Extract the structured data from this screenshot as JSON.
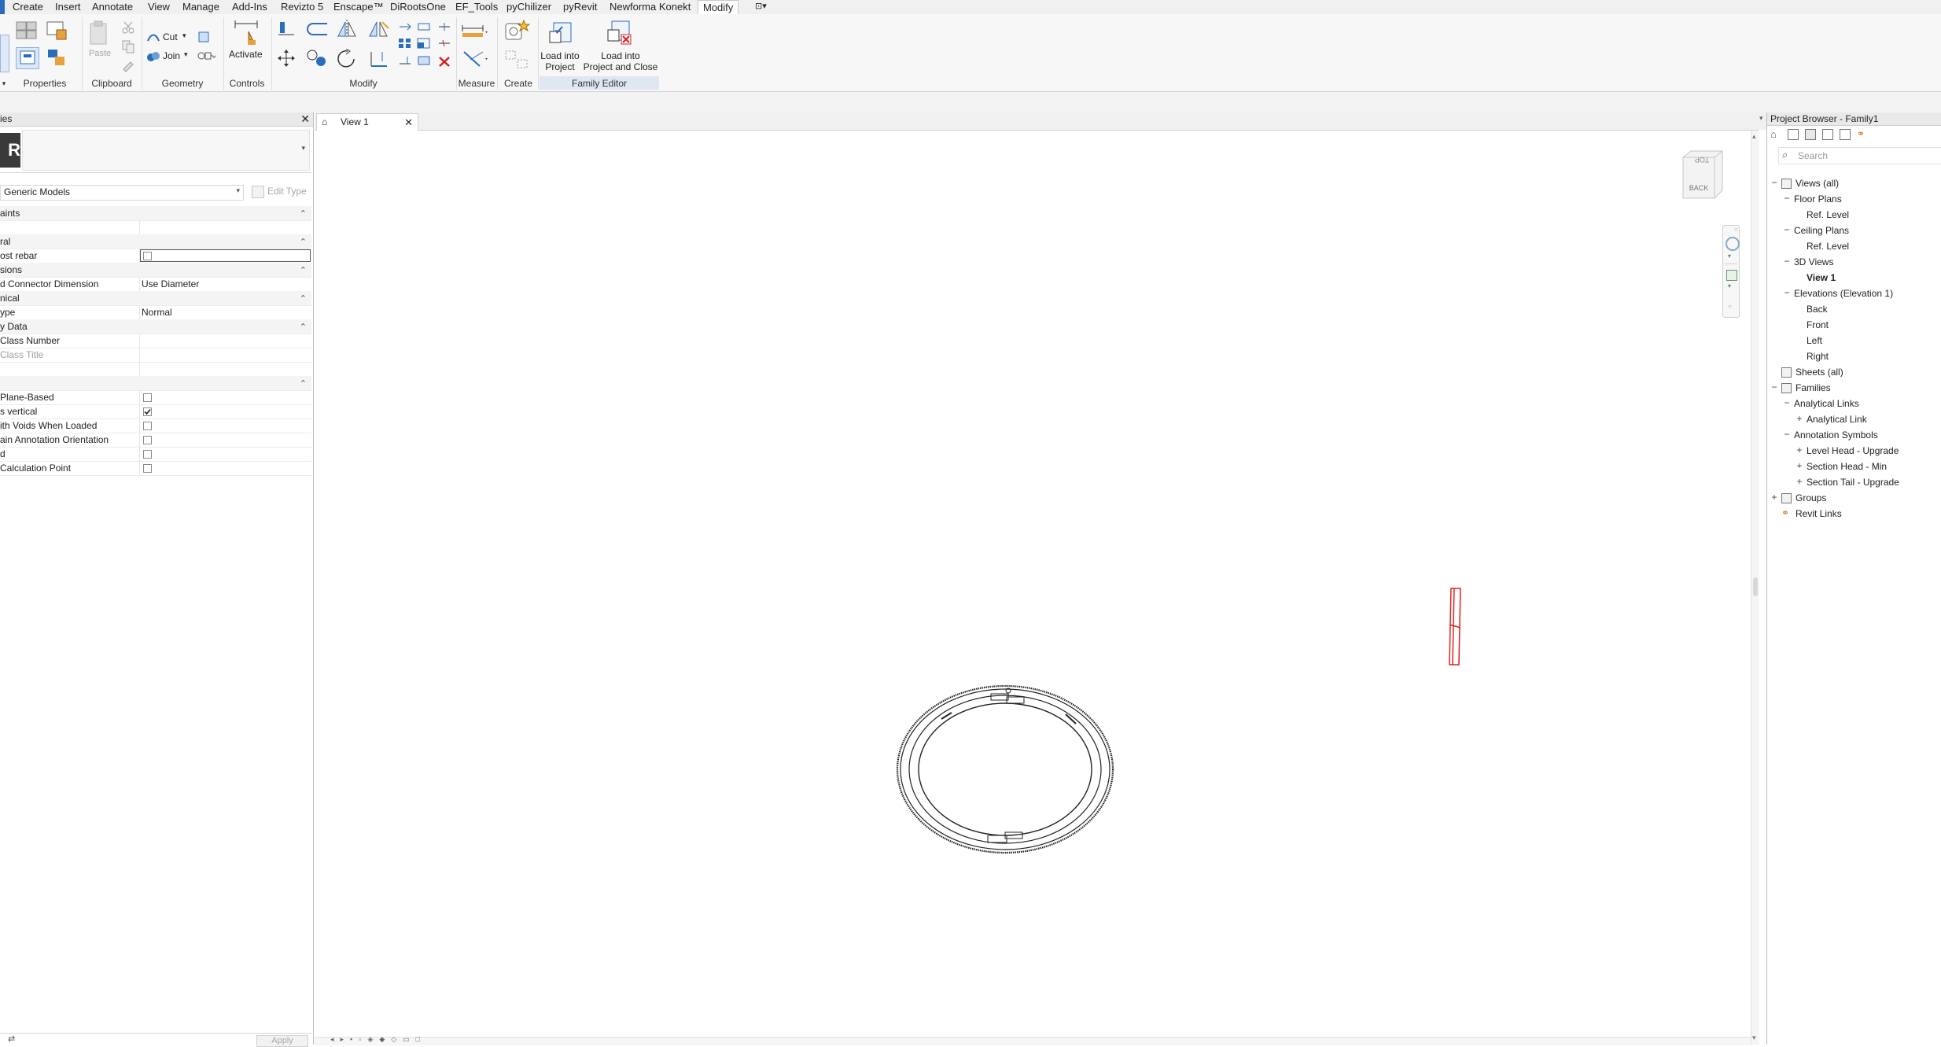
{
  "menubar": {
    "tabs": [
      "Create",
      "Insert",
      "Annotate",
      "View",
      "Manage",
      "Add-Ins",
      "Revizto 5",
      "Enscape™",
      "DiRootsOne",
      "EF_Tools",
      "pyChilizer",
      "pyRevit",
      "Newforma Konekt",
      "Modify"
    ],
    "active": "Modify",
    "extra": "⊡▾"
  },
  "ribbon": {
    "panels": {
      "properties": "Properties",
      "clipboard": "Clipboard",
      "geometry": "Geometry",
      "controls": "Controls",
      "modify": "Modify",
      "measure": "Measure",
      "create": "Create",
      "family_editor": "Family Editor"
    },
    "paste": "Paste",
    "cut": "Cut",
    "join": "Join",
    "activate": "Activate",
    "load_into_project": "Load into\nProject",
    "load_into_project_close": "Load into\nProject and Close"
  },
  "properties": {
    "title": "ies",
    "type_selector": "Generic Models",
    "edit_type": "Edit Type",
    "apply": "Apply",
    "rows": [
      {
        "k": "aints",
        "group": true
      },
      {
        "k": "",
        "v": ""
      },
      {
        "k": "ral",
        "group": true
      },
      {
        "k": "ost rebar",
        "checkbox": true,
        "checked": false,
        "highlight": true
      },
      {
        "k": "sions",
        "group": true
      },
      {
        "k": "d Connector Dimension",
        "v": "Use Diameter"
      },
      {
        "k": "nical",
        "group": true
      },
      {
        "k": "ype",
        "v": "Normal"
      },
      {
        "k": "y Data",
        "group": true
      },
      {
        "k": "Class Number",
        "v": ""
      },
      {
        "k": "Class Title",
        "v": "",
        "gray": true
      },
      {
        "k": "",
        "v": ""
      },
      {
        "k": "",
        "group": true
      },
      {
        "k": "Plane-Based",
        "checkbox": true,
        "checked": false
      },
      {
        "k": "s vertical",
        "checkbox": true,
        "checked": true
      },
      {
        "k": "ith Voids When Loaded",
        "checkbox": true,
        "checked": false
      },
      {
        "k": "ain Annotation Orientation",
        "checkbox": true,
        "checked": false
      },
      {
        "k": "d",
        "checkbox": true,
        "checked": false
      },
      {
        "k": " Calculation Point",
        "checkbox": true,
        "checked": false
      }
    ]
  },
  "view": {
    "tab_label": "View 1",
    "viewcube_top": "TOP",
    "viewcube_back": "BACK"
  },
  "browser": {
    "title": "Project Browser - Family1",
    "search_placeholder": "Search",
    "tree": [
      {
        "label": "Views (all)",
        "depth": 0,
        "toggle": "−",
        "icon": true
      },
      {
        "label": "Floor Plans",
        "depth": 1,
        "toggle": "−"
      },
      {
        "label": "Ref. Level",
        "depth": 2
      },
      {
        "label": "Ceiling Plans",
        "depth": 1,
        "toggle": "−"
      },
      {
        "label": "Ref. Level",
        "depth": 2
      },
      {
        "label": "3D Views",
        "depth": 1,
        "toggle": "−"
      },
      {
        "label": "View 1",
        "depth": 2,
        "bold": true
      },
      {
        "label": "Elevations (Elevation 1)",
        "depth": 1,
        "toggle": "−"
      },
      {
        "label": "Back",
        "depth": 2
      },
      {
        "label": "Front",
        "depth": 2
      },
      {
        "label": "Left",
        "depth": 2
      },
      {
        "label": "Right",
        "depth": 2
      },
      {
        "label": "Sheets (all)",
        "depth": 0,
        "icon": true
      },
      {
        "label": "Families",
        "depth": 0,
        "toggle": "−",
        "icon": true
      },
      {
        "label": "Analytical Links",
        "depth": 1,
        "toggle": "−"
      },
      {
        "label": "Analytical Link",
        "depth": 2,
        "toggle": "+"
      },
      {
        "label": "Annotation Symbols",
        "depth": 1,
        "toggle": "−"
      },
      {
        "label": "Level Head - Upgrade",
        "depth": 2,
        "toggle": "+"
      },
      {
        "label": "Section Head - Min",
        "depth": 2,
        "toggle": "+"
      },
      {
        "label": "Section Tail - Upgrade",
        "depth": 2,
        "toggle": "+"
      },
      {
        "label": "Groups",
        "depth": 0,
        "toggle": "+",
        "icon": true
      },
      {
        "label": "Revit Links",
        "depth": 0,
        "icon": true
      }
    ]
  },
  "colors": {
    "accent": "#2a6ebb",
    "selection_red": "#e02020",
    "family_editor_band": "#dfe7f2"
  }
}
